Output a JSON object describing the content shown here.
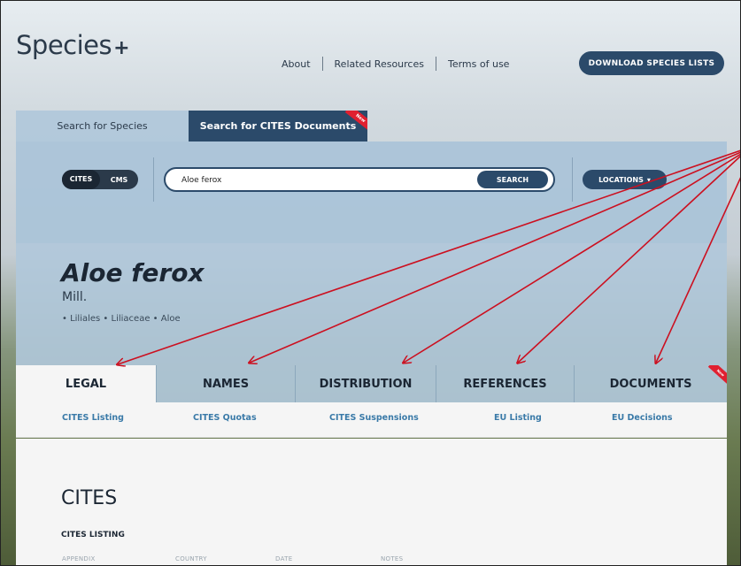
{
  "header": {
    "logo_text": "Species",
    "logo_plus": "+",
    "nav": [
      "About",
      "Related Resources",
      "Terms of use"
    ],
    "download_label": "DOWNLOAD SPECIES LISTS"
  },
  "search_tabs": {
    "species_label": "Search for Species",
    "documents_label": "Search for CITES Documents",
    "documents_ribbon": "New"
  },
  "search": {
    "toggle": [
      "CITES",
      "CMS"
    ],
    "value": "Aloe ferox",
    "button_label": "SEARCH",
    "locations_label": "LOCATIONS",
    "locations_caret": "▾"
  },
  "species": {
    "name": "Aloe ferox",
    "author": "Mill.",
    "taxonomy": "• Liliales • Liliaceae • Aloe"
  },
  "tabs": [
    "LEGAL",
    "NAMES",
    "DISTRIBUTION",
    "REFERENCES",
    "DOCUMENTS"
  ],
  "documents_tab_ribbon": "New",
  "subtabs": [
    "CITES Listing",
    "CITES Quotas",
    "CITES Suspensions",
    "EU Listing",
    "EU Decisions"
  ],
  "section": {
    "heading": "CITES",
    "subheading": "CITES LISTING",
    "columns": [
      "APPENDIX",
      "COUNTRY",
      "DATE",
      "NOTES"
    ]
  },
  "colors": {
    "accent_dark": "#2b4a6a",
    "panel_blue": "#b0c8da",
    "link_blue": "#3a7aa8",
    "arrow_red": "#cc1020"
  }
}
